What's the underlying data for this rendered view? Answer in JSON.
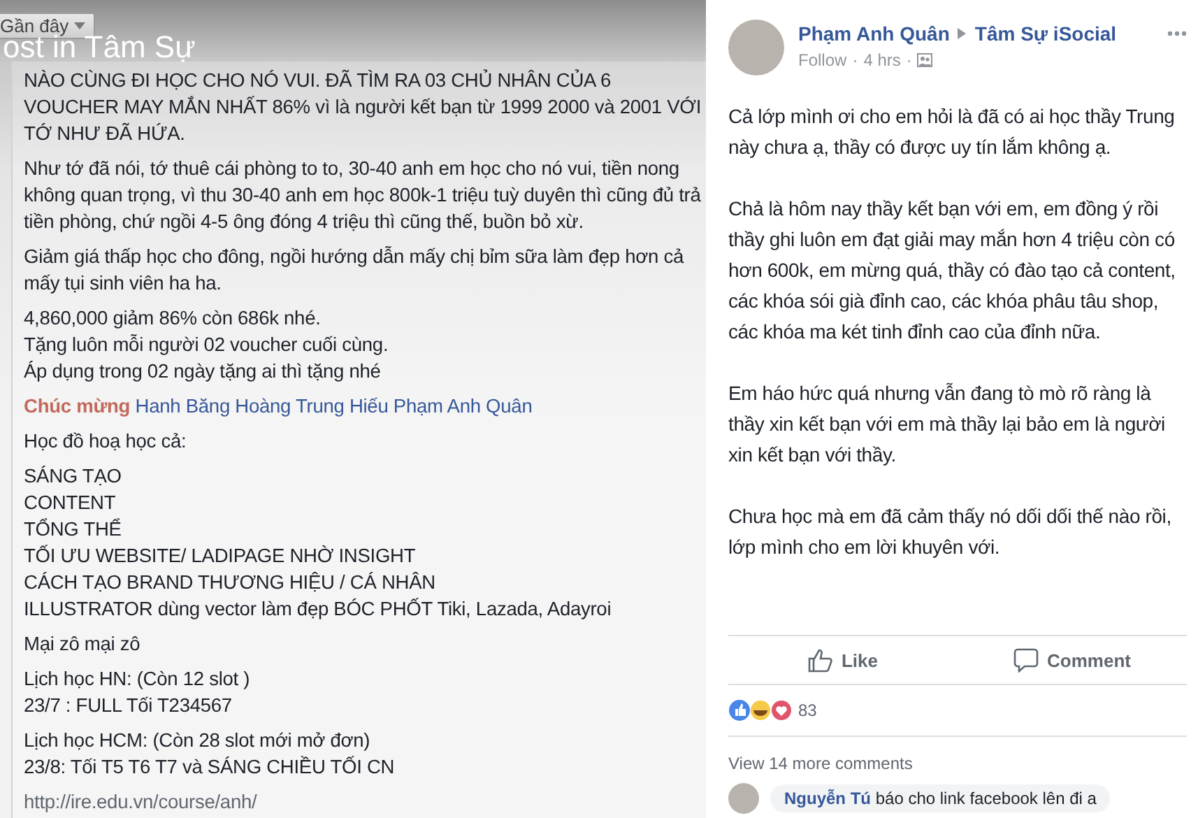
{
  "group_header": {
    "sort_button": {
      "label": "Gần đây"
    },
    "title": "ost in Tâm Sự"
  },
  "shared_post": {
    "paragraphs": [
      {
        "kind": "text",
        "text": "NÀO CÙNG ĐI HỌC CHO NÓ VUI. ĐÃ TÌM RA 03 CHỦ NHÂN CỦA 6 VOUCHER MAY MẮN NHẤT 86% vì là người kết bạn từ 1999 2000 và 2001 VỚI TỚ NHƯ ĐÃ HỨA."
      },
      {
        "kind": "text",
        "text": "Như tớ đã nói, tớ thuê cái phòng to to, 30-40 anh em học cho nó vui, tiền nong không quan trọng, vì thu 30-40 anh em học 800k-1 triệu tuỳ duyên thì cũng đủ trả tiền phòng, chứ ngồi 4-5 ông đóng 4 triệu thì cũng thế, buồn bỏ xừ."
      },
      {
        "kind": "text",
        "text": "Giảm giá thấp học cho đông, ngồi hướng dẫn mấy chị bỉm sữa làm đẹp hơn cả mấy tụi sinh viên ha ha."
      },
      {
        "kind": "lines",
        "lines": [
          "4,860,000 giảm 86% còn 686k nhé.",
          "Tặng luôn mỗi người 02 voucher cuối cùng.",
          "Áp dụng trong 02 ngày tặng ai thì tặng nhé"
        ]
      },
      {
        "kind": "mention",
        "lead": "Chúc mừng",
        "names": "Hanh Băng Hoàng Trung Hiếu Phạm Anh Quân"
      },
      {
        "kind": "text",
        "text": "Học đồ hoạ học cả:"
      },
      {
        "kind": "lines",
        "lines": [
          "SÁNG TẠO",
          "CONTENT",
          "TỔNG THỂ",
          "TỐI ƯU WEBSITE/ LADIPAGE NHỜ INSIGHT",
          "CÁCH TẠO BRAND THƯƠNG HIỆU / CÁ NHÂN",
          "ILLUSTRATOR dùng vector làm đẹp BÓC PHỐT Tiki, Lazada, Adayroi"
        ]
      },
      {
        "kind": "text",
        "text": "Mại zô mại zô"
      },
      {
        "kind": "lines",
        "lines": [
          "Lịch học HN: (Còn 12 slot )",
          "23/7 : FULL Tối T234567"
        ]
      },
      {
        "kind": "lines",
        "lines": [
          "Lịch học HCM: (Còn 28 slot mới mở đơn)",
          "23/8: Tối T5 T6 T7 và SÁNG CHIỀU TỐI CN"
        ]
      },
      {
        "kind": "link",
        "text": "http://ire.edu.vn/course/anh/"
      }
    ]
  },
  "post": {
    "author": "Phạm Anh Quân",
    "group": "Tâm Sự iSocial",
    "follow": "Follow",
    "separator": "·",
    "time": "4 hrs",
    "paragraphs": [
      "Cả lớp mình ơi cho em hỏi là đã có ai học thầy Trung này chưa ạ, thầy có được uy tín lắm không ạ.",
      "Chả là hôm nay thầy kết bạn với em, em đồng ý rồi thầy ghi luôn em đạt giải may mắn hơn 4 triệu còn có hơn 600k, em mừng quá, thầy có đào tạo cả content, các khóa sói già đỉnh cao, các khóa phâu tâu shop, các khóa ma két tinh đỉnh cao của đỉnh nữa.",
      "Em háo hức quá nhưng vẫn đang tò mò rõ ràng là thầy xin kết bạn với em mà thầy lại bảo em là người xin kết bạn với thầy.",
      "Chưa học mà em đã cảm thấy nó dối dối thế nào rồi, lớp mình cho em lời khuyên với."
    ],
    "actions": [
      {
        "kind": "like",
        "label": "Like"
      },
      {
        "kind": "comment",
        "label": "Comment"
      }
    ],
    "reactions": {
      "count": "83"
    },
    "more_comments": "View 14 more comments",
    "comment": {
      "author": "Nguyễn Tú",
      "text": "báo cho link facebook lên đi a"
    }
  }
}
